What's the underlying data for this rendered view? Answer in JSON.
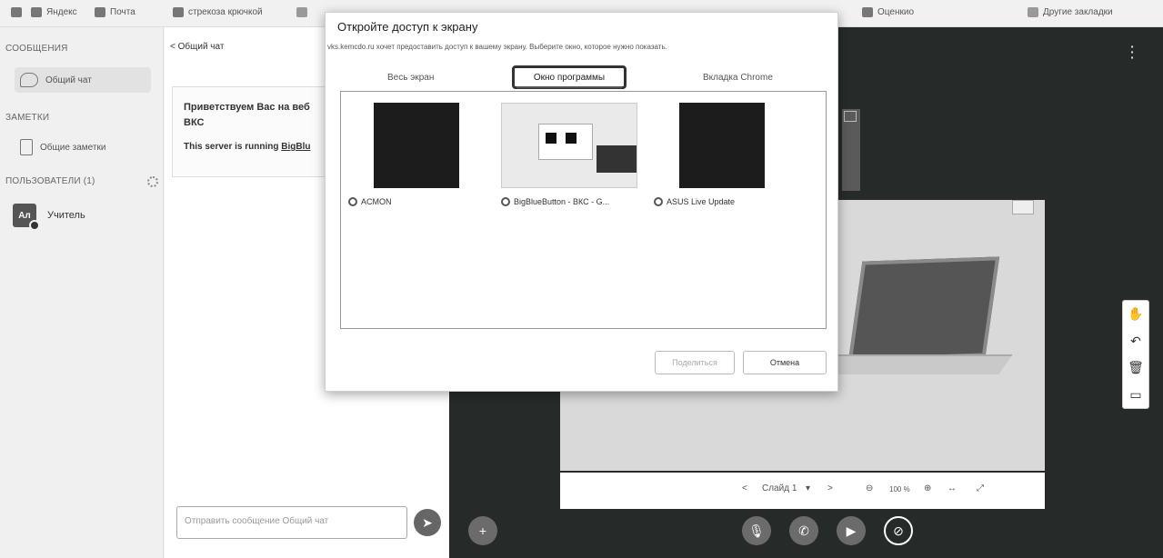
{
  "bookmarks": [
    {
      "label": "Яндекс"
    },
    {
      "label": "Почта"
    },
    {
      "label": "стрекоза крючкой"
    },
    {
      "label": "Оценкио"
    },
    {
      "label": "Другие закладки"
    }
  ],
  "sidebar": {
    "messages_title": "СООБЩЕНИЯ",
    "public_chat": "Общий чат",
    "notes_title": "ЗАМЕТКИ",
    "shared_notes": "Общие заметки",
    "users_title": "ПОЛЬЗОВАТЕЛИ (1)",
    "user_initials": "Ал",
    "user_name": "Учитель"
  },
  "chat": {
    "header": "Общий чат",
    "welcome_line1": "Приветствуем Вас на веб",
    "welcome_line2": "ВКС",
    "server_prefix": "This server is running",
    "server_link": "BigBlu",
    "input_placeholder": "Отправить сообщение Общий чат"
  },
  "dialog": {
    "title": "Откройте доступ к экрану",
    "description": "vks.kemcdo.ru хочет предоставить доступ к вашему экрану. Выберите окно, которое нужно показать.",
    "tabs": [
      "Весь экран",
      "Окно программы",
      "Вкладка Chrome"
    ],
    "selected_tab": "Окно программы",
    "windows": [
      {
        "label": "ACMON"
      },
      {
        "label": "BigBlueButton - ВКС - G..."
      },
      {
        "label": "ASUS Live Update"
      }
    ],
    "share_button": "Поделиться",
    "cancel_button": "Отмена"
  },
  "presentation": {
    "slide_label": "Слайд 1",
    "zoom": "100 %"
  },
  "colors": {
    "presentation_bg": "#262b2a",
    "dialog_bg": "#ffffff"
  }
}
